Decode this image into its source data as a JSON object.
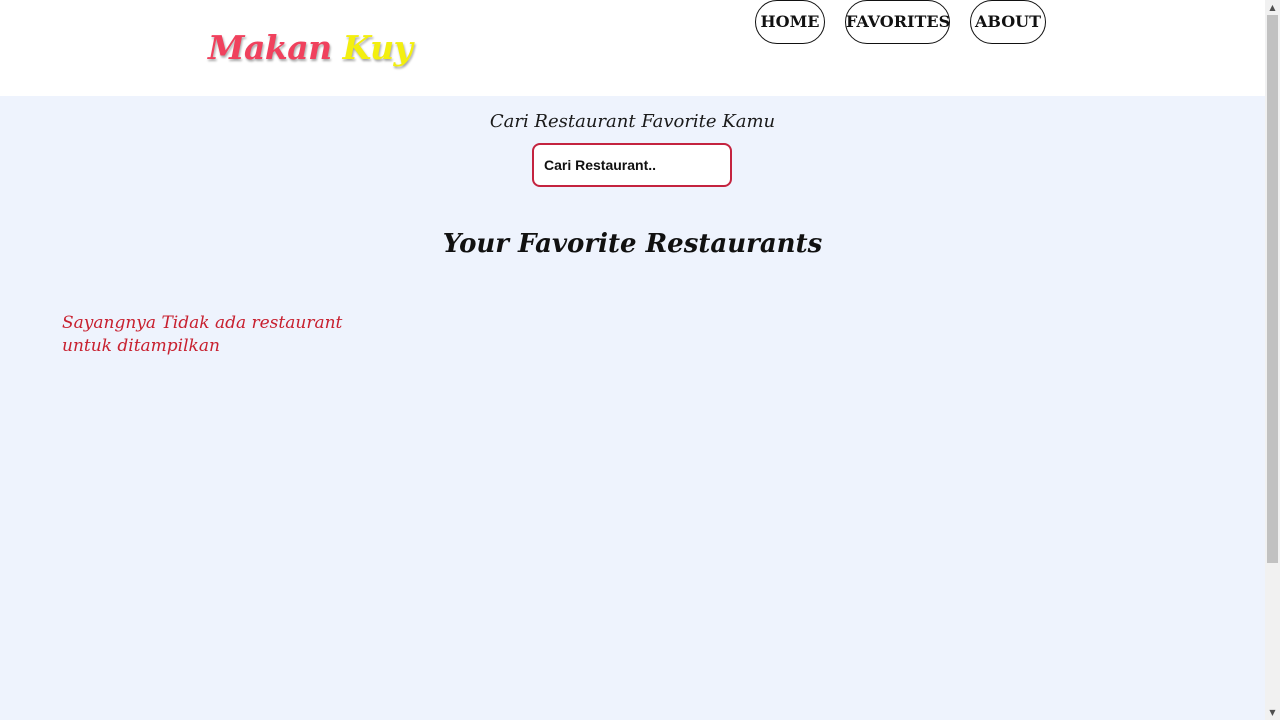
{
  "header": {
    "logo": {
      "word1": "Makan",
      "word2": "Kuy"
    },
    "nav": [
      {
        "label": "HOME"
      },
      {
        "label": "FAVORITES"
      },
      {
        "label": "ABOUT"
      }
    ]
  },
  "search": {
    "caption": "Cari Restaurant Favorite Kamu",
    "placeholder": "Cari Restaurant.."
  },
  "main": {
    "title": "Your Favorite Restaurants",
    "empty_message": "Sayangnya Tidak ada restaurant untuk ditampilkan"
  },
  "colors": {
    "logo_primary": "#f0415d",
    "logo_secondary": "#f3ef0f",
    "page_background": "#eef3fd",
    "accent_border": "#c4233f",
    "empty_text": "#c8202f"
  }
}
